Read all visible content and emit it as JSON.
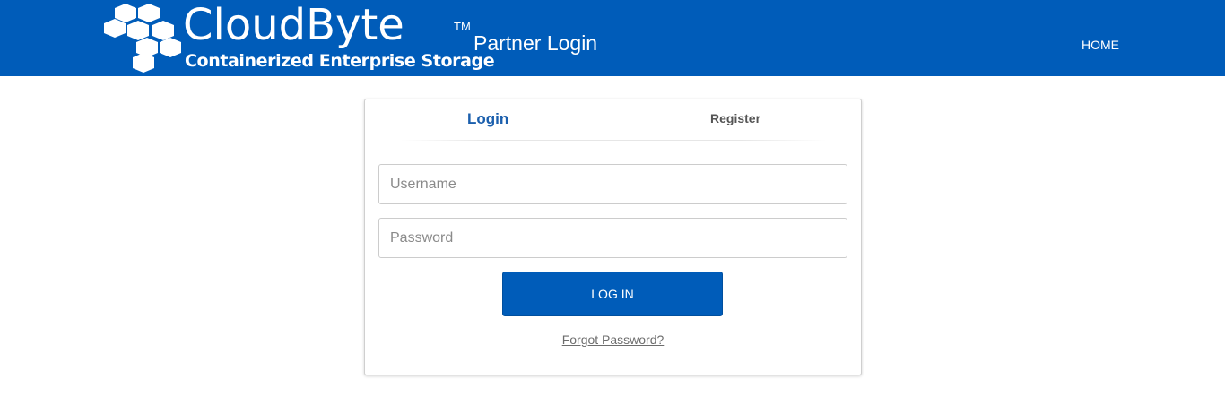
{
  "header": {
    "brand_name": "CloudByte",
    "trademark": "TM",
    "tagline": "Containerized Enterprise Storage",
    "site_title": "Partner Login",
    "nav_home": "HOME",
    "bg_color": "#005cb9"
  },
  "auth_card": {
    "tabs": [
      {
        "label": "Login",
        "active": true
      },
      {
        "label": "Register",
        "active": false
      }
    ],
    "username": {
      "value": "",
      "placeholder": "Username"
    },
    "password": {
      "value": "",
      "placeholder": "Password"
    },
    "submit_label": "LOG IN",
    "forgot_label": "Forgot Password?",
    "accent_color": "#1b5fad"
  }
}
